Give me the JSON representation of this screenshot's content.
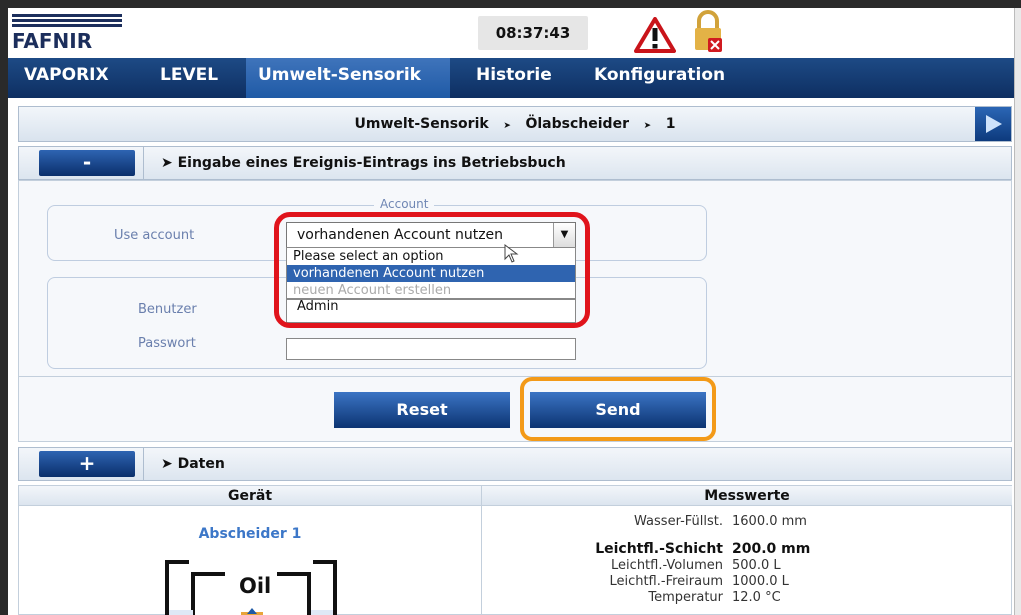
{
  "header": {
    "logo_text": "FAFNIR",
    "clock": "08:37:43",
    "warning_icon": "warning-triangle-icon",
    "lock_icon": "padlock-icon"
  },
  "nav": {
    "items": [
      "VAPORIX",
      "LEVEL",
      "Umwelt-Sensorik",
      "Historie",
      "Konfiguration"
    ],
    "active": "Umwelt-Sensorik"
  },
  "breadcrumb": {
    "part1": "Umwelt-Sensorik",
    "sep": "➤",
    "part2": "Ölabscheider",
    "part3": "1"
  },
  "section_entry": {
    "toggle": "-",
    "title": "➤ Eingabe eines Ereignis-Eintrags ins Betriebsbuch"
  },
  "form": {
    "account_legend": "Account",
    "use_account_label": "Use account",
    "account_select_value": "vorhandenen Account nutzen",
    "account_options": [
      "Please select an option",
      "vorhandenen Account nutzen",
      "neuen Account erstellen"
    ],
    "selected_option_index": 1,
    "user_label": "Benutzer",
    "user_value": "Admin",
    "password_label": "Passwort",
    "password_value": "",
    "reset_label": "Reset",
    "send_label": "Send"
  },
  "section_data": {
    "toggle": "+",
    "title": "➤ Daten"
  },
  "data_table": {
    "col_device": "Gerät",
    "col_values": "Messwerte",
    "device_name": "Abscheider 1",
    "tank_label": "Oil",
    "rows": [
      {
        "key": "Wasser-Füllst.",
        "value": "1600.0 mm"
      },
      {
        "key": "Leichtfl.-Schicht",
        "value": "200.0 mm"
      },
      {
        "key": "Leichtfl.-Volumen",
        "value": "500.0 L"
      },
      {
        "key": "Leichtfl.-Freiraum",
        "value": "1000.0 L"
      },
      {
        "key": "Temperatur",
        "value": "12.0 °C"
      }
    ]
  },
  "colors": {
    "nav_bg": "#0e2f62",
    "nav_active": "#2f64b0",
    "highlight_red": "#e0141c",
    "highlight_orange": "#f39a18",
    "device_link": "#3c77c8"
  }
}
